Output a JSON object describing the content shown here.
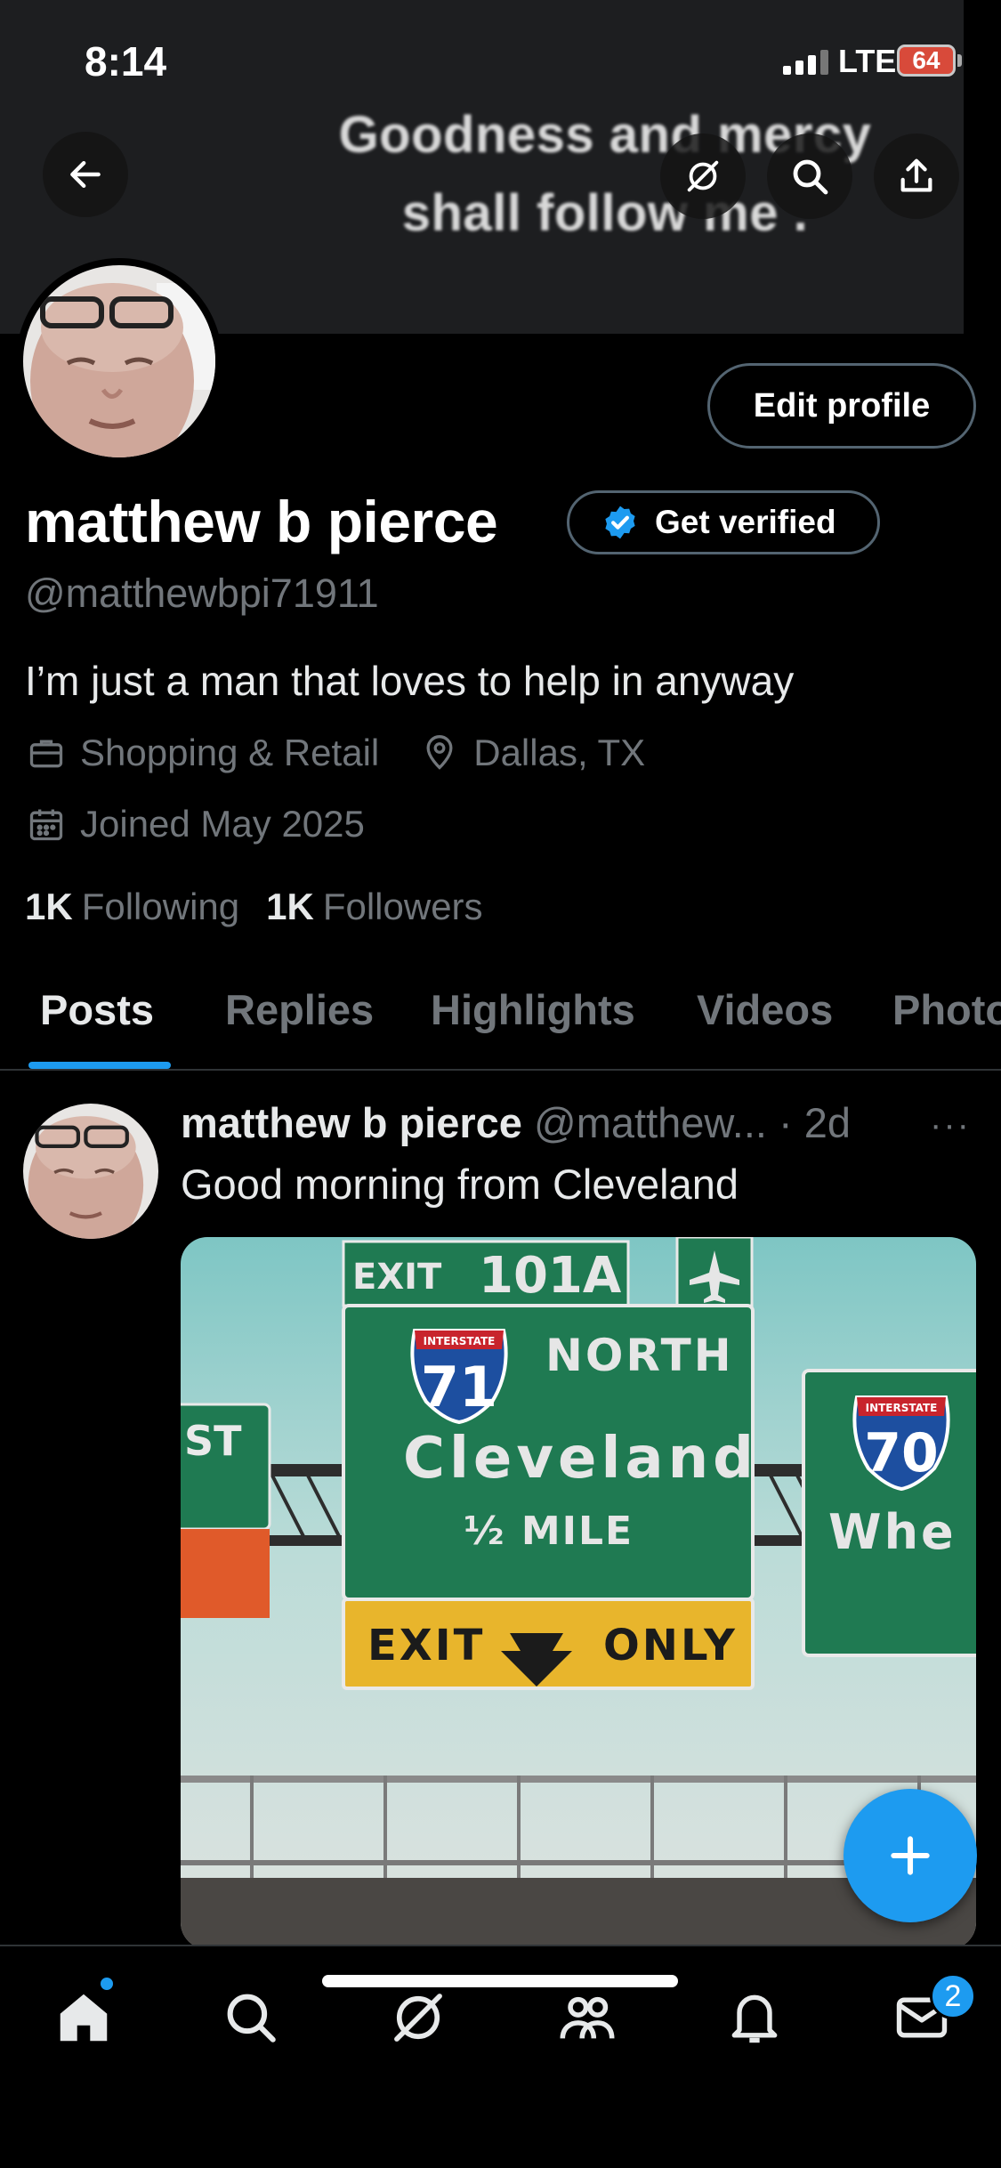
{
  "status_bar": {
    "time": "8:14",
    "network": "LTE",
    "battery": "64"
  },
  "banner": {
    "line1": "Goodness and mercy",
    "line2": "shall follow me ."
  },
  "top_actions": {
    "back_icon": "arrow-left-icon",
    "grok_icon": "grok-icon",
    "search_icon": "search-icon",
    "share_icon": "share-icon"
  },
  "profile": {
    "edit_label": "Edit profile",
    "display_name": "matthew b pierce",
    "verified_label": "Get verified",
    "handle": "@matthewbpi71911",
    "bio": "I’m just a man that loves to help in anyway",
    "category": "Shopping & Retail",
    "location": "Dallas, TX",
    "joined": "Joined May 2025",
    "following_count": "1K",
    "following_label": "Following",
    "followers_count": "1K",
    "followers_label": "Followers"
  },
  "tabs": [
    "Posts",
    "Replies",
    "Highlights",
    "Videos",
    "Photos"
  ],
  "post": {
    "author": "matthew b pierce",
    "handle_time": "@matthew... · 2d",
    "more": "···",
    "text": "Good morning from Cleveland",
    "sign": {
      "exit": "EXIT",
      "exit_number": "101A",
      "route_main": "71",
      "interstate": "INTERSTATE",
      "direction": "NORTH",
      "city": "Cleveland",
      "distance": "½ MILE",
      "exit_only_left": "EXIT",
      "exit_only_right": "ONLY",
      "route_side": "70",
      "side_partial": "Whe",
      "left_partial": "ST"
    }
  },
  "bottom_nav": {
    "messages_badge": "2"
  },
  "colors": {
    "accent": "#1d9bf0",
    "background": "#000000",
    "muted": "#71767b",
    "sign_green": "#1f7a52",
    "sign_yellow": "#e8b52c"
  }
}
